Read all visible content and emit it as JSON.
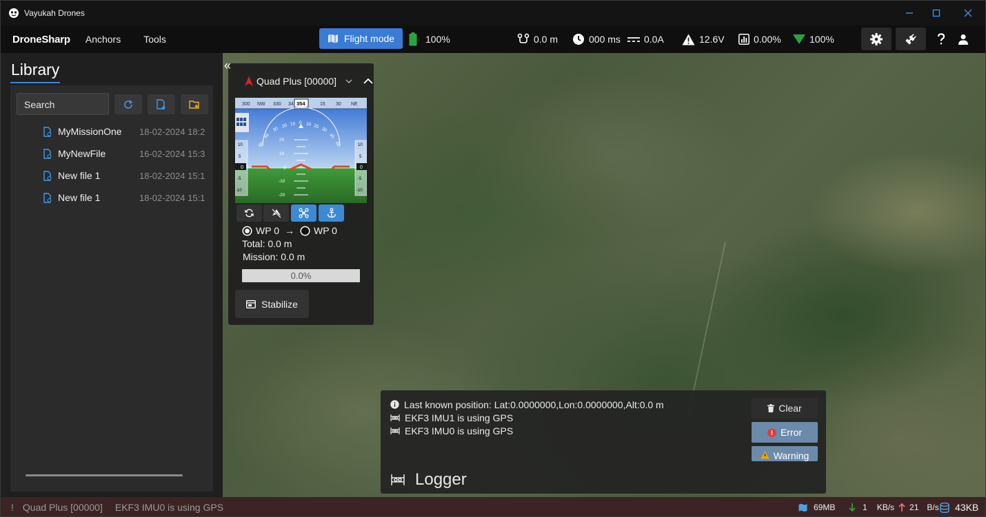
{
  "window": {
    "title": "Vayukah Drones"
  },
  "topbar": {
    "brand": "DroneSharp",
    "menu": [
      "Anchors",
      "Tools"
    ],
    "flight_mode": "Flight mode",
    "battery_pct": "100%",
    "distance": "0.0 m",
    "latency": "000 ms",
    "current": "0.0A",
    "voltage": "12.6V",
    "throttle": "0.00%",
    "signal": "100%"
  },
  "library": {
    "title": "Library",
    "search_placeholder": "Search",
    "files": [
      {
        "name": "MyMissionOne",
        "date": "18-02-2024 18:2"
      },
      {
        "name": "MyNewFile",
        "date": "16-02-2024 15:3"
      },
      {
        "name": "New file 1",
        "date": "18-02-2024 15:1"
      },
      {
        "name": "New file 1",
        "date": "18-02-2024 15:1"
      }
    ]
  },
  "flight_panel": {
    "collapse": "«",
    "vehicle": "Quad Plus [00000]",
    "compass": {
      "ticks": [
        "300",
        "NW",
        "330",
        "34",
        "15",
        "30",
        "NE"
      ],
      "heading": "354"
    },
    "attitude": {
      "pitch_labels": [
        "20",
        "10",
        "0",
        "-10",
        "-20"
      ],
      "roll_labels": [
        "60",
        "45",
        "30",
        "20",
        "10",
        "0",
        "10",
        "20",
        "30",
        "45",
        "60"
      ],
      "left_tape": [
        "10",
        "5",
        "0",
        "-5",
        "-10"
      ],
      "right_tape": [
        "10",
        "5",
        "0",
        "-5",
        "-10"
      ],
      "left_value": "0",
      "right_value": "0"
    },
    "wp_from": "WP 0",
    "wp_arrow": "→",
    "wp_to": "WP 0",
    "total": "Total: 0.0 m",
    "mission": "Mission: 0.0 m",
    "progress": 0.0,
    "progress_label": "0.0%",
    "mode_button": "Stabilize"
  },
  "logger": {
    "title": "Logger",
    "messages": [
      {
        "icon": "info-icon",
        "text": "Last known position: Lat:0.0000000,Lon:0.0000000,Alt:0.0 m"
      },
      {
        "icon": "sensor-icon",
        "text": "EKF3 IMU1 is using GPS"
      },
      {
        "icon": "sensor-icon",
        "text": "EKF3 IMU0 is using GPS"
      }
    ],
    "clear": "Clear",
    "error": "Error",
    "warning": "Warning"
  },
  "statusbar": {
    "bang": "!",
    "vehicle": "Quad Plus [00000]",
    "message": "EKF3 IMU0 is using GPS",
    "map_mem": "69MB",
    "down": "1",
    "down_unit": "KB/s",
    "up": "21",
    "up_unit": "B/s",
    "storage": "43KB"
  },
  "colors": {
    "accent": "#3a7bd5",
    "battery": "#2ea043",
    "signal": "#2ea043",
    "error": "#e53935",
    "warning": "#f0a500"
  }
}
